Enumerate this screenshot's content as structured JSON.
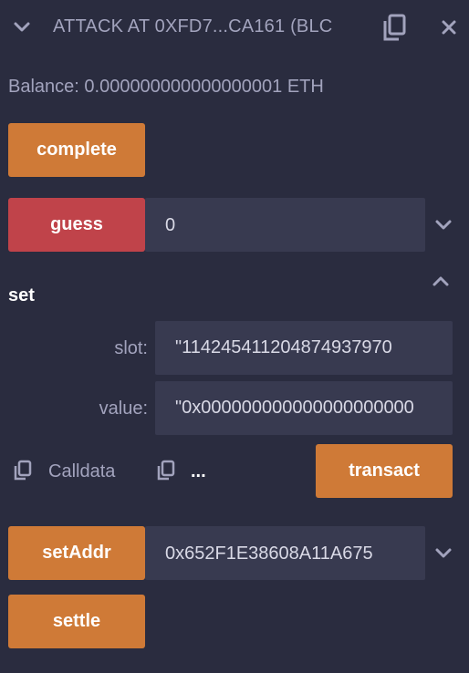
{
  "header": {
    "title": "ATTACK AT 0XFD7...CA161 (BLC",
    "collapse_icon": "chevron-down-icon",
    "copy_icon": "copy-icon",
    "close_icon": "close-icon"
  },
  "balance": "Balance: 0.000000000000000001 ETH",
  "functions": {
    "complete": {
      "label": "complete"
    },
    "guess": {
      "label": "guess",
      "value": "0"
    },
    "set": {
      "label": "set",
      "slot_label": "slot:",
      "slot_value": "\"114245411204874937970",
      "value_label": "value:",
      "value_value": "\"0x000000000000000000000",
      "calldata_label": "Calldata",
      "more_label": "...",
      "transact_label": "transact"
    },
    "setAddr": {
      "label": "setAddr",
      "value": "0x652F1E38608A11A675"
    },
    "settle": {
      "label": "settle"
    }
  },
  "colors": {
    "background": "#2a2c3f",
    "orange": "#cf7a37",
    "red": "#c0434a",
    "input_bg": "#383a50"
  }
}
